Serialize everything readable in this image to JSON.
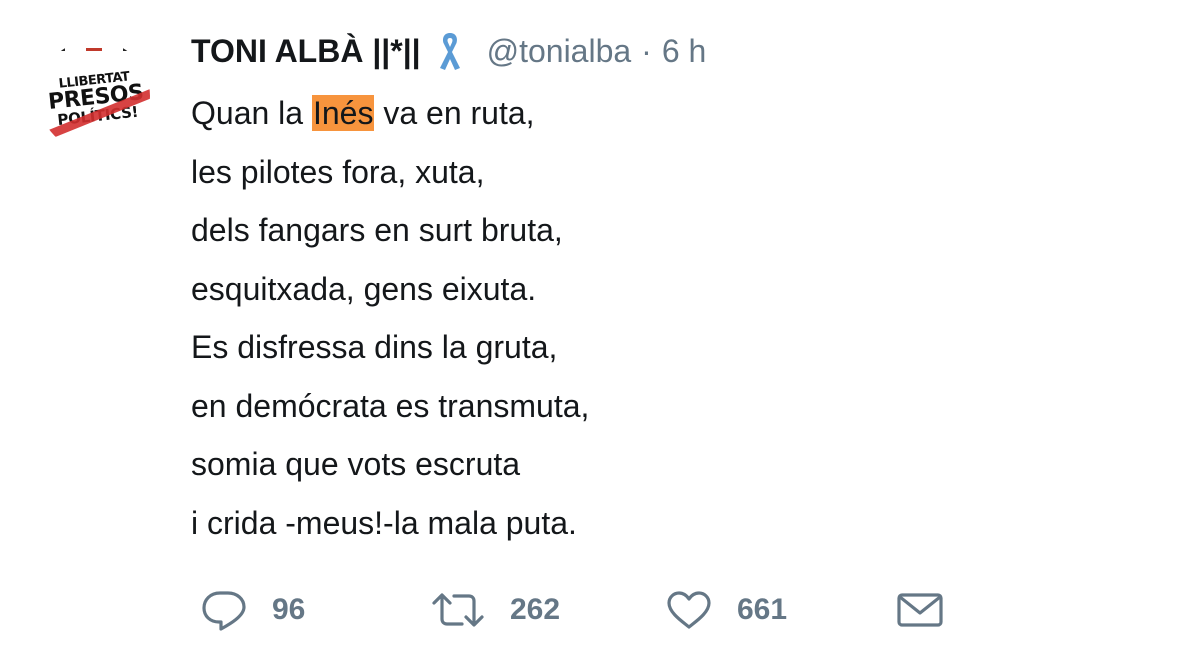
{
  "tweet": {
    "author": {
      "name": "TONI ALBÀ ||*||",
      "handle": "@tonialba",
      "separator": "·",
      "time": "6 h",
      "ribbon_color": "#5b9bd5",
      "avatar": {
        "line1": "LLIBERTAT",
        "line2": "PRESOS",
        "line3": "POLÍTICS!"
      }
    },
    "lines": [
      {
        "pre": "Quan la ",
        "highlight": "Inés",
        "post": " va en ruta,"
      },
      {
        "text": "les pilotes fora, xuta,"
      },
      {
        "text": "dels fangars en surt bruta,"
      },
      {
        "text": "esquitxada, gens eixuta."
      },
      {
        "text": "Es disfressa dins la gruta,"
      },
      {
        "text": "en demócrata es transmuta,"
      },
      {
        "text": "somia que vots escruta"
      },
      {
        "text": "i crida -meus!-la mala puta."
      }
    ],
    "highlight_color": "#f7943d",
    "actions": {
      "reply": {
        "icon": "reply-icon",
        "count": "96"
      },
      "retweet": {
        "icon": "retweet-icon",
        "count": "262"
      },
      "like": {
        "icon": "heart-icon",
        "count": "661"
      },
      "message": {
        "icon": "envelope-icon"
      }
    }
  }
}
